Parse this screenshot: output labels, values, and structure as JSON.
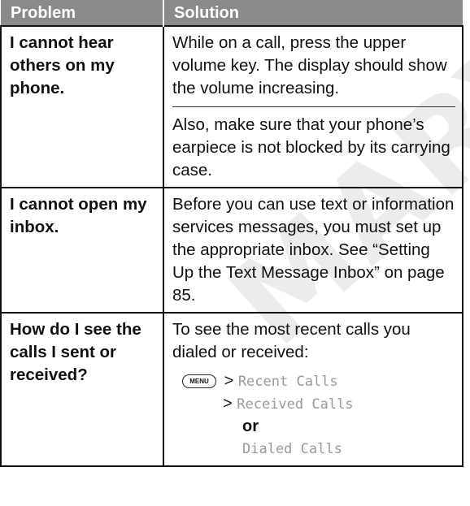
{
  "header": {
    "problem": "Problem",
    "solution": "Solution"
  },
  "rows": [
    {
      "problem": "I cannot hear others on my phone.",
      "solution": [
        "While on a call, press the upper volume key. The display should show the volume increasing.",
        "Also, make sure that your phone’s earpiece is not blocked by its carrying case."
      ]
    },
    {
      "problem": "I cannot open my inbox.",
      "solution": [
        "Before you can use text or information services messages, you must set up the appropriate inbox. See “Setting Up the Text Message Inbox” on page 85."
      ]
    },
    {
      "problem": "How do I see the calls I sent or received?",
      "solution": [
        "To see the most recent calls you dialed or received:"
      ],
      "steps": {
        "menu_key": "MENU",
        "separator": ">",
        "recent_calls": "Recent Calls",
        "received_calls": "Received Calls",
        "or": "or",
        "dialed_calls": "Dialed Calls"
      }
    }
  ],
  "watermark": "MARY"
}
